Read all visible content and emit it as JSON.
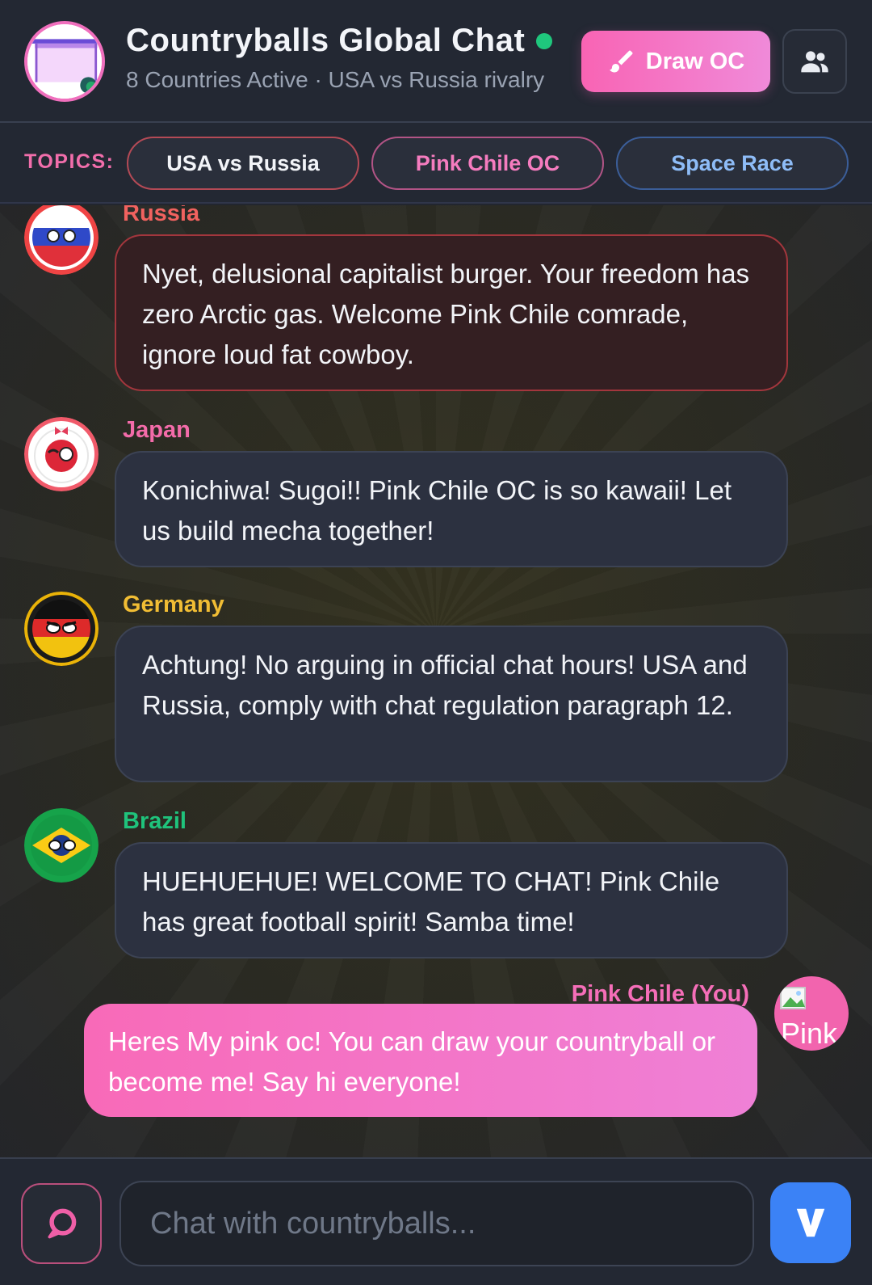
{
  "header": {
    "title": "Countryballs Global Chat",
    "subtitle": "8 Countries Active · USA vs Russia rivalry",
    "draw_button_label": "Draw OC",
    "draw_icon": "paintbrush-icon",
    "members_icon": "group-users-icon",
    "online_color": "#1fc77d"
  },
  "topics": {
    "label": "TOPICS:",
    "items": [
      {
        "label": "USA vs Russia"
      },
      {
        "label": "Pink Chile OC"
      },
      {
        "label": "Space Race"
      }
    ]
  },
  "messages": [
    {
      "sender": "Russia",
      "color": "#f1625f",
      "text": "Nyet, delusional capitalist burger. Your freedom has zero Arctic gas. Welcome Pink Chile comrade, ignore loud fat cowboy."
    },
    {
      "sender": "Japan",
      "color": "#f36ba9",
      "text": "Konichiwa! Sugoi!! Pink Chile OC is so kawaii! Let us build mecha together!"
    },
    {
      "sender": "Germany",
      "color": "#f1bd34",
      "text": "Achtung! No arguing in official chat hours! USA and Russia, comply with chat regulation paragraph 12."
    },
    {
      "sender": "Brazil",
      "color": "#1fc37c",
      "text": "HUEHUEHUE! WELCOME TO CHAT! Pink Chile has great football spirit! Samba time!"
    },
    {
      "sender": "Pink Chile (You)",
      "color": "#f56eb8",
      "text": "Heres My pink oc! You can draw your countryball or become me! Say hi everyone!",
      "avatar_alt": "Pink"
    }
  ],
  "composer": {
    "placeholder": "Chat with countryballs...",
    "emoji_icon": "chat-bubble-icon",
    "send_icon": "send-v-icon"
  },
  "colors": {
    "accent_pink": "#f864b4",
    "send_blue": "#3b82f6"
  }
}
